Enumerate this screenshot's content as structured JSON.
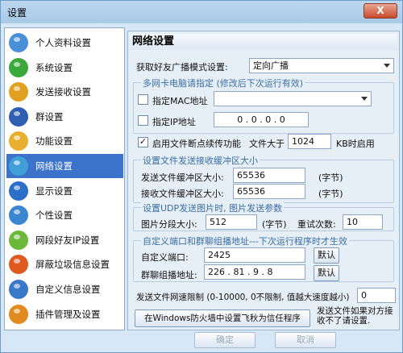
{
  "window": {
    "title": "设置",
    "close_label": "X"
  },
  "sidebar": {
    "items": [
      {
        "label": "个人资料设置",
        "icon": "profile-icon",
        "color": "#4a90d9"
      },
      {
        "label": "系统设置",
        "icon": "system-icon",
        "color": "#3aa83a"
      },
      {
        "label": "发送接收设置",
        "icon": "send-receive-icon",
        "color": "#e0a020"
      },
      {
        "label": "群设置",
        "icon": "group-icon",
        "color": "#2e5fb0"
      },
      {
        "label": "功能设置",
        "icon": "function-icon",
        "color": "#e8b030"
      },
      {
        "label": "网络设置",
        "icon": "network-icon",
        "color": "#3fa0d8",
        "active": true
      },
      {
        "label": "显示设置",
        "icon": "display-icon",
        "color": "#2a6fc8"
      },
      {
        "label": "个性设置",
        "icon": "personal-icon",
        "color": "#3a86d0"
      },
      {
        "label": "网段好友IP设置",
        "icon": "ip-icon",
        "color": "#6cb83a"
      },
      {
        "label": "屏蔽垃圾信息设置",
        "icon": "block-spam-icon",
        "color": "#e05a20"
      },
      {
        "label": "自定义信息设置",
        "icon": "custom-info-icon",
        "color": "#3a78c8"
      },
      {
        "label": "插件管理及设置",
        "icon": "plugin-icon",
        "color": "#e08a20"
      }
    ]
  },
  "panel": {
    "title": "网络设置",
    "broadcast_label": "获取好友广播模式设置:",
    "broadcast_value": "定向广播",
    "nic_group_title": "多网卡电脑请指定 (修改后下次运行有效)",
    "mac_label": "指定MAC地址",
    "ip_label": "指定IP地址",
    "ip_value": "0 . 0 . 0 . 0",
    "resume_label": "启用文件断点续传功能",
    "file_size_label": "文件大于",
    "file_size_value": "1024",
    "kb_enable_label": "KB时启用",
    "buffer_group_title": "设置文件发送接收缓冲区大小",
    "send_buffer_label": "发送文件缓冲区大小:",
    "send_buffer_value": "65536",
    "send_buffer_unit": "(字节)",
    "recv_buffer_label": "接收文件缓冲区大小:",
    "recv_buffer_value": "65536",
    "recv_buffer_unit": "(字节)",
    "udp_group_title": "设置UDP发送图片时, 图片发送参数",
    "segment_label": "图片分段大小:",
    "segment_value": "512",
    "segment_unit": "(字节)",
    "retry_label": "重试次数:",
    "retry_value": "10",
    "port_group_title": "自定义端口和群聊组播地址---下次运行程序时才生效",
    "port_label": "自定义端口:",
    "port_value": "2425",
    "default_label_1": "默认",
    "multicast_label": "群聊组播地址:",
    "multicast_value": "226 . 81 . 9 . 8",
    "default_label_2": "默认",
    "speed_limit_label": "发送文件网速限制 (0-10000, 0不限制, 值越大速度越小)",
    "speed_limit_value": "0",
    "firewall_button": "在Windows防火墙中设置飞秋为信任程序",
    "firewall_note": "发送文件如果对方接收不了请设置."
  },
  "footer": {
    "ok_label": "确定",
    "cancel_label": "取消"
  }
}
